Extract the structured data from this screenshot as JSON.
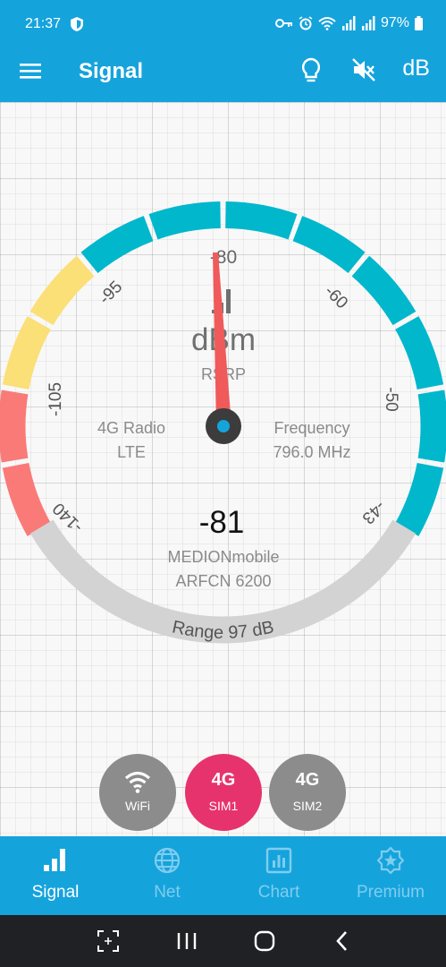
{
  "status_bar": {
    "time": "21:37",
    "battery": "97%"
  },
  "app_bar": {
    "title": "Signal",
    "db_label": "dB"
  },
  "gauge": {
    "scale_labels": [
      "-140",
      "-105",
      "-95",
      "-80",
      "-60",
      "-50",
      "-43"
    ],
    "unit": "dBm",
    "metric": "RSRP",
    "value": "-81",
    "left_label": "4G Radio",
    "left_value": "LTE",
    "right_label": "Frequency",
    "right_value": "796.0 MHz",
    "operator": "MEDIONmobile",
    "arfcn": "ARFCN 6200",
    "range_label": "Range 97 dB"
  },
  "sim_selector": {
    "wifi": {
      "label": "WiFi",
      "color": "#8c8c8c"
    },
    "sim1": {
      "tech": "4G",
      "label": "SIM1",
      "color": "#e7336d"
    },
    "sim2": {
      "tech": "4G",
      "label": "SIM2",
      "color": "#8c8c8c"
    }
  },
  "bottom_nav": {
    "items": [
      {
        "label": "Signal",
        "icon": "signal-bars-icon",
        "active": true
      },
      {
        "label": "Net",
        "icon": "globe-icon",
        "active": false
      },
      {
        "label": "Chart",
        "icon": "chart-icon",
        "active": false
      },
      {
        "label": "Premium",
        "icon": "premium-badge-icon",
        "active": false
      }
    ]
  },
  "colors": {
    "primary": "#15a3dc",
    "good": "#00b7cc",
    "fair": "#fbdf77",
    "poor": "#fa7a78",
    "needle": "#f05a5a",
    "range_arc": "#d3d3d3"
  }
}
